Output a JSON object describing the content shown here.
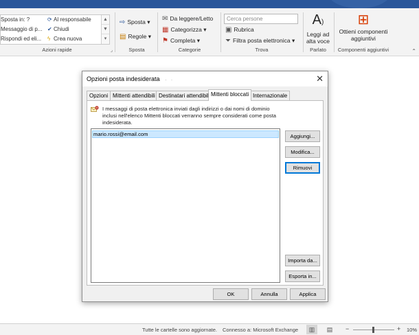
{
  "ribbon": {
    "quick_steps": {
      "items": [
        "Sposta in: ?",
        "Messaggio di p...",
        "Rispondi ed eli...",
        "Al responsabile",
        "Chiudi",
        "Crea nuova"
      ],
      "label": "Azioni rapide"
    },
    "move": {
      "move_label": "Sposta",
      "rules_label": "Regole",
      "label": "Sposta"
    },
    "tags": {
      "unread_label": "Da leggere/Letto",
      "categorize_label": "Categorizza",
      "followup_label": "Completa",
      "label": "Categorie"
    },
    "find": {
      "search_placeholder": "Cerca persone",
      "address_book_label": "Rubrica",
      "filter_label": "Filtra posta elettronica",
      "label": "Trova"
    },
    "speech": {
      "read_aloud_line1": "Leggi ad",
      "read_aloud_line2": "alta voce",
      "label": "Parlato"
    },
    "addins": {
      "get_addins_line1": "Ottieni componenti",
      "get_addins_line2": "aggiuntivi",
      "label": "Componenti aggiuntivi"
    }
  },
  "dialog": {
    "title": "Opzioni posta indesiderata",
    "tabs": [
      "Opzioni",
      "Mittenti attendibili",
      "Destinatari attendibili",
      "Mittenti bloccati",
      "Internazionale"
    ],
    "active_tab": "Mittenti bloccati",
    "info_text": "I messaggi di posta elettronica inviati dagli indirizzi o dai nomi di dominio inclusi nell'elenco Mittenti bloccati verranno sempre considerati come posta indesiderata.",
    "blocked_list": [
      "mario.rossi@email.com"
    ],
    "side_buttons": {
      "add": "Aggiungi...",
      "edit": "Modifica...",
      "remove": "Rimuovi",
      "import": "Importa da...",
      "export": "Esporta in..."
    },
    "footer_buttons": {
      "ok": "OK",
      "cancel": "Annulla",
      "apply": "Applica"
    }
  },
  "statusbar": {
    "folders_status": "Tutte le cartelle sono aggiornate.",
    "connection_status": "Connesso a: Microsoft Exchange",
    "zoom_minus": "−",
    "zoom_plus": "+",
    "zoom_level": "10%"
  },
  "colors": {
    "accent": "#2b579a",
    "selection": "#cce8ff",
    "focus": "#0078d7",
    "addins_icon": "#d83b01"
  }
}
